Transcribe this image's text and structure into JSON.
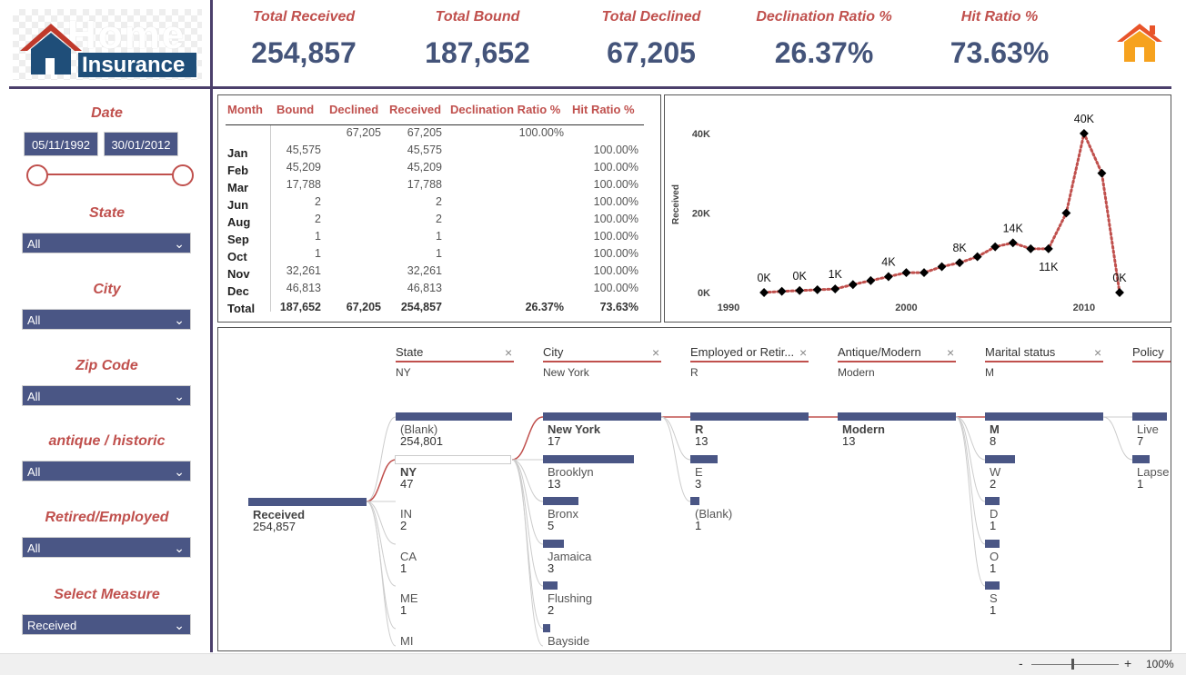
{
  "logo": {
    "ghost_text": "Home",
    "word": "Insurance"
  },
  "kpis": [
    {
      "label": "Total Received",
      "value": "254,857"
    },
    {
      "label": "Total Bound",
      "value": "187,652"
    },
    {
      "label": "Total Declined",
      "value": "67,205"
    },
    {
      "label": "Declination Ratio %",
      "value": "26.37%"
    },
    {
      "label": "Hit Ratio %",
      "value": "73.63%"
    }
  ],
  "filters": {
    "date": {
      "label": "Date",
      "start": "05/11/1992",
      "end": "30/01/2012"
    },
    "state": {
      "label": "State",
      "value": "All"
    },
    "city": {
      "label": "City",
      "value": "All"
    },
    "zip": {
      "label": "Zip Code",
      "value": "All"
    },
    "antique": {
      "label": "antique / historic",
      "value": "All"
    },
    "retired": {
      "label": "Retired/Employed",
      "value": "All"
    },
    "measure": {
      "label": "Select Measure",
      "value": "Received"
    }
  },
  "table": {
    "headers": [
      "Month",
      "Bound",
      "Declined",
      "Received",
      "Declination Ratio %",
      "Hit Ratio %"
    ],
    "rows": [
      [
        "",
        "",
        "67,205",
        "67,205",
        "100.00%",
        ""
      ],
      [
        "Jan",
        "45,575",
        "",
        "45,575",
        "",
        "100.00%"
      ],
      [
        "Feb",
        "45,209",
        "",
        "45,209",
        "",
        "100.00%"
      ],
      [
        "Mar",
        "17,788",
        "",
        "17,788",
        "",
        "100.00%"
      ],
      [
        "Jun",
        "2",
        "",
        "2",
        "",
        "100.00%"
      ],
      [
        "Aug",
        "2",
        "",
        "2",
        "",
        "100.00%"
      ],
      [
        "Sep",
        "1",
        "",
        "1",
        "",
        "100.00%"
      ],
      [
        "Oct",
        "1",
        "",
        "1",
        "",
        "100.00%"
      ],
      [
        "Nov",
        "32,261",
        "",
        "32,261",
        "",
        "100.00%"
      ],
      [
        "Dec",
        "46,813",
        "",
        "46,813",
        "",
        "100.00%"
      ]
    ],
    "total": [
      "Total",
      "187,652",
      "67,205",
      "254,857",
      "26.37%",
      "73.63%"
    ]
  },
  "chart_data": {
    "type": "line",
    "ylabel": "Received",
    "x_ticks": [
      "1990",
      "2000",
      "2010"
    ],
    "y_ticks": [
      "0K",
      "20K",
      "40K"
    ],
    "xlim": [
      1990,
      2012
    ],
    "ylim": [
      0,
      45000
    ],
    "x": [
      1992,
      1993,
      1994,
      1995,
      1996,
      1997,
      1998,
      1999,
      2000,
      2001,
      2002,
      2003,
      2004,
      2005,
      2006,
      2007,
      2008,
      2009,
      2010,
      2011,
      2012
    ],
    "values": [
      0,
      300,
      500,
      700,
      900,
      2000,
      3000,
      4000,
      5000,
      5000,
      6500,
      7500,
      9000,
      11500,
      12500,
      11000,
      11000,
      20000,
      40000,
      30000,
      0
    ],
    "data_labels": [
      {
        "i": 0,
        "text": "0K"
      },
      {
        "i": 2,
        "text": "0K"
      },
      {
        "i": 4,
        "text": "1K"
      },
      {
        "i": 7,
        "text": "4K"
      },
      {
        "i": 11,
        "text": "8K"
      },
      {
        "i": 14,
        "text": "14K"
      },
      {
        "i": 16,
        "text": "11K"
      },
      {
        "i": 18,
        "text": "40K"
      },
      {
        "i": 20,
        "text": "0K"
      }
    ],
    "line_color": "#c0504d",
    "marker_color": "#000000"
  },
  "decomp": {
    "root": {
      "label": "Received",
      "value": "254,857"
    },
    "levels": [
      {
        "title": "State",
        "selected": "NY",
        "nodes": [
          {
            "label": "(Blank)",
            "value": "254,801",
            "bar": 1.0
          },
          {
            "label": "NY",
            "value": "47",
            "bar": 0,
            "bold": true
          },
          {
            "label": "IN",
            "value": "2"
          },
          {
            "label": "CA",
            "value": "1"
          },
          {
            "label": "ME",
            "value": "1"
          },
          {
            "label": "MI",
            "value": ""
          }
        ]
      },
      {
        "title": "City",
        "selected": "New York",
        "nodes": [
          {
            "label": "New York",
            "value": "17",
            "bar": 1.0,
            "bold": true
          },
          {
            "label": "Brooklyn",
            "value": "13",
            "bar": 0.77
          },
          {
            "label": "Bronx",
            "value": "5",
            "bar": 0.3
          },
          {
            "label": "Jamaica",
            "value": "3",
            "bar": 0.18
          },
          {
            "label": "Flushing",
            "value": "2",
            "bar": 0.12
          },
          {
            "label": "Bayside",
            "value": "",
            "bar": 0.06
          }
        ]
      },
      {
        "title": "Employed or Retir...",
        "selected": "R",
        "nodes": [
          {
            "label": "R",
            "value": "13",
            "bar": 1.0,
            "bold": true
          },
          {
            "label": "E",
            "value": "3",
            "bar": 0.23
          },
          {
            "label": "(Blank)",
            "value": "1",
            "bar": 0.08
          }
        ]
      },
      {
        "title": "Antique/Modern",
        "selected": "Modern",
        "nodes": [
          {
            "label": "Modern",
            "value": "13",
            "bar": 1.0,
            "bold": true
          }
        ]
      },
      {
        "title": "Marital status",
        "selected": "M",
        "nodes": [
          {
            "label": "M",
            "value": "8",
            "bar": 1.0,
            "bold": true
          },
          {
            "label": "W",
            "value": "2",
            "bar": 0.25
          },
          {
            "label": "D",
            "value": "1",
            "bar": 0.12
          },
          {
            "label": "O",
            "value": "1",
            "bar": 0.12
          },
          {
            "label": "S",
            "value": "1",
            "bar": 0.12
          }
        ]
      },
      {
        "title": "Policy",
        "selected": "",
        "nodes": [
          {
            "label": "Live",
            "value": "7",
            "bar": 1.0
          },
          {
            "label": "Lapse",
            "value": "1",
            "bar": 0.5
          }
        ]
      }
    ]
  },
  "status": {
    "minus": "-",
    "plus": "+",
    "zoom": "100%"
  }
}
